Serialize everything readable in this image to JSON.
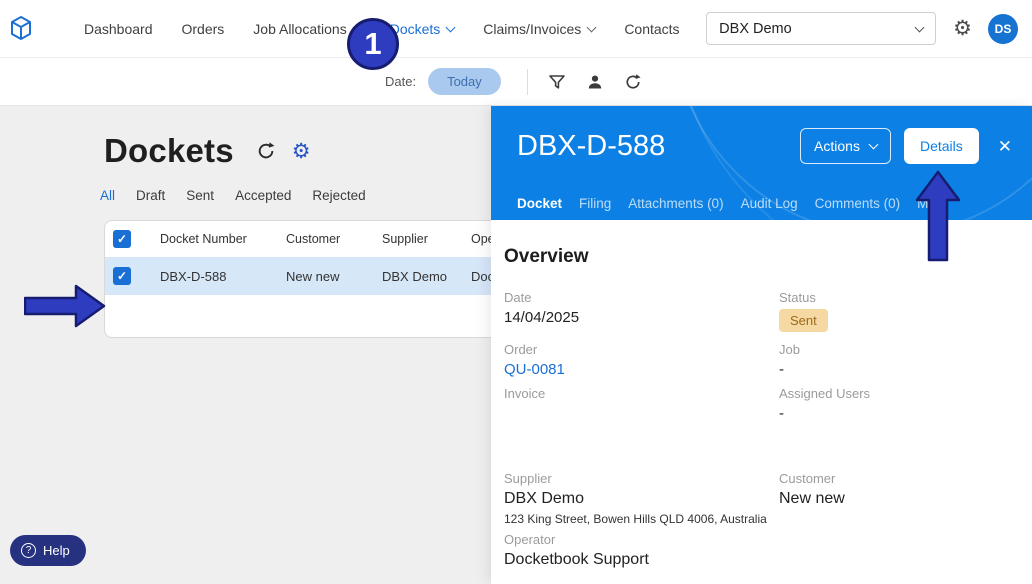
{
  "nav": {
    "items": [
      {
        "label": "Dashboard"
      },
      {
        "label": "Orders"
      },
      {
        "label": "Job Allocations"
      },
      {
        "label": "Dockets"
      },
      {
        "label": "Claims/Invoices"
      },
      {
        "label": "Contacts"
      }
    ],
    "org_select_value": "DBX Demo",
    "avatar_initials": "DS",
    "gear_glyph": "⚙"
  },
  "toolbar": {
    "date_label": "Date:",
    "today_button": "Today"
  },
  "dockets": {
    "title": "Dockets",
    "tabs": [
      "All",
      "Draft",
      "Sent",
      "Accepted",
      "Rejected"
    ],
    "active_tab": "All",
    "table": {
      "columns": [
        "Docket Number",
        "Customer",
        "Supplier",
        "Operator"
      ],
      "rows": [
        {
          "docket_number": "DBX-D-588",
          "customer": "New new",
          "supplier": "DBX Demo",
          "operator": "Docketbook Support"
        }
      ]
    }
  },
  "detail_panel": {
    "title": "DBX-D-588",
    "actions_button": "Actions",
    "details_button": "Details",
    "close_glyph": "✕",
    "tabs": [
      "Docket",
      "Filing",
      "Attachments (0)",
      "Audit Log",
      "Comments (0)",
      "Map"
    ],
    "active_tab": "Docket",
    "overview": {
      "heading": "Overview",
      "date_label": "Date",
      "date_value": "14/04/2025",
      "status_label": "Status",
      "status_value": "Sent",
      "order_label": "Order",
      "order_value": "QU-0081",
      "job_label": "Job",
      "job_value": "-",
      "invoice_label": "Invoice",
      "invoice_value": "",
      "assigned_users_label": "Assigned Users",
      "assigned_users_value": "-",
      "supplier_label": "Supplier",
      "supplier_value": "DBX Demo",
      "supplier_address": "123 King Street, Bowen Hills QLD 4006, Australia",
      "customer_label": "Customer",
      "customer_value": "New new",
      "operator_label": "Operator",
      "operator_value": "Docketbook Support"
    }
  },
  "help": {
    "label": "Help",
    "icon_glyph": "?"
  },
  "annotations": {
    "step_number": "1"
  },
  "colors": {
    "accent_blue": "#1a6fd4",
    "panel_blue": "#0c80e4",
    "row_highlight": "#d6e7f8",
    "badge_bg": "#f6d9a2",
    "badge_text": "#9a6a1b",
    "annotation_fill": "#2e3cc0",
    "annotation_stroke": "#161c70",
    "help_bg": "#263280",
    "today_pill_bg": "#a9c9ee"
  }
}
